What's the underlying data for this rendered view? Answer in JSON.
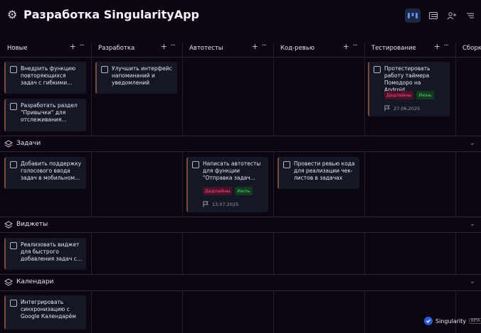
{
  "header": {
    "title": "Разработка SingularityApp",
    "view_buttons": [
      "board-view-icon",
      "list-view-icon",
      "members-icon",
      "sort-icon"
    ]
  },
  "columns": [
    {
      "label": "Новые"
    },
    {
      "label": "Разработка"
    },
    {
      "label": "Автотесты"
    },
    {
      "label": "Код-ревью"
    },
    {
      "label": "Тестирование"
    },
    {
      "label": "Сборк"
    }
  ],
  "groups": [
    {
      "label": "Задачи"
    },
    {
      "label": "Виджеты"
    },
    {
      "label": "Календари"
    }
  ],
  "cards": {
    "c1": {
      "text": "Внедрить функцию повторяющихся задач с гибкими..."
    },
    "c2": {
      "text": "Разработать раздел \"Привычки\" для отслеживания..."
    },
    "c3": {
      "text": "Улучшить интерфейс напоминаний и уведомлений"
    },
    "c4": {
      "text": "Протестировать работу таймера Помодоро на Android...",
      "tag1": "Дедлайны",
      "tag2": "Июнь",
      "date": "27.06.2025"
    },
    "c5": {
      "text": "Добавить поддержку голосового ввода задач в мобильном..."
    },
    "c6": {
      "text": "Написать автотесты для функции \"Отправка задач...",
      "tag1": "Дедлайны",
      "tag2": "Июль",
      "date": "13.07.2025"
    },
    "c7": {
      "text": "Провести ревью кода для реализации чек-листов в задачах"
    },
    "c8": {
      "text": "Реализовать виджет для быстрого добавления задач с..."
    },
    "c9": {
      "text": "Интегрировать синхронизацию с Google Календарём"
    }
  },
  "brand": {
    "name": "Singularity",
    "badge": "BETA"
  },
  "colors": {
    "background": "#0b0612",
    "card": "#141726",
    "tag_red": "#ff4f7a",
    "tag_green": "#4fd06f",
    "accent": "#2c5bd8"
  }
}
